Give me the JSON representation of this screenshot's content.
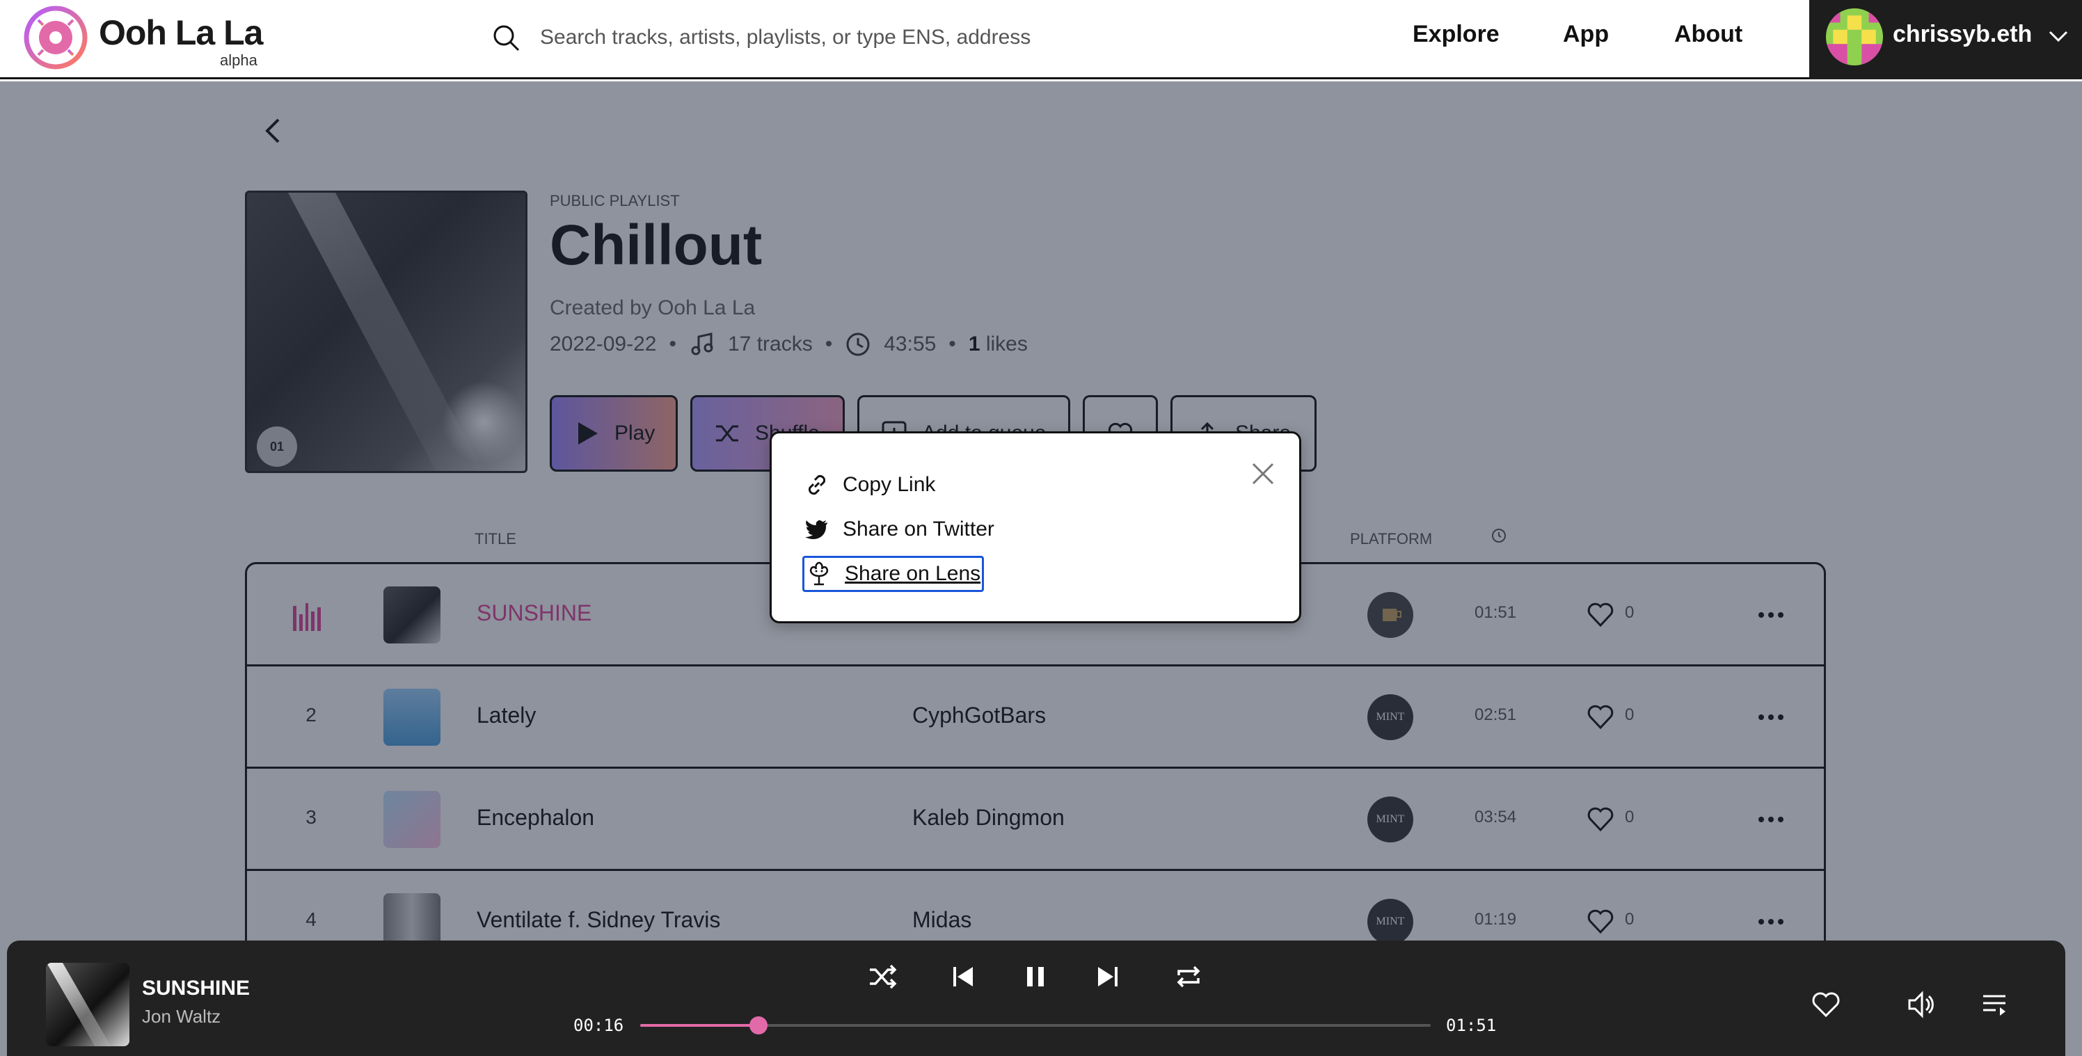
{
  "header": {
    "brand": "Ooh La La",
    "brand_tag": "alpha",
    "search_placeholder": "Search tracks, artists, playlists, or type ENS, address",
    "nav": [
      "Explore",
      "App",
      "About"
    ],
    "user": "chrissyb.eth"
  },
  "playlist": {
    "kind": "PUBLIC PLAYLIST",
    "title": "Chillout",
    "creator": "Created by Ooh La La",
    "date": "2022-09-22",
    "tracks": "17 tracks",
    "duration": "43:55",
    "likes_count": "1",
    "likes_label": "likes",
    "cover_label": "01"
  },
  "buttons": {
    "play": "Play",
    "shuffle": "Shuffle",
    "add_to_queue": "Add to queue",
    "share": "Share"
  },
  "columns": {
    "title": "TITLE",
    "platform": "PLATFORM"
  },
  "tracks": [
    {
      "num": "",
      "title": "SUNSHINE",
      "artist": "",
      "platform": "",
      "duration": "01:51",
      "likes": "0",
      "active": true
    },
    {
      "num": "2",
      "title": "Lately",
      "artist": "CyphGotBars",
      "platform": "MINT",
      "duration": "02:51",
      "likes": "0"
    },
    {
      "num": "3",
      "title": "Encephalon",
      "artist": "Kaleb Dingmon",
      "platform": "MINT",
      "duration": "03:54",
      "likes": "0"
    },
    {
      "num": "4",
      "title": "Ventilate f. Sidney Travis",
      "artist": "Midas",
      "platform": "MINT",
      "duration": "01:19",
      "likes": "0"
    }
  ],
  "share_modal": {
    "copy_link": "Copy Link",
    "twitter": "Share on Twitter",
    "lens": "Share on Lens"
  },
  "player": {
    "title": "SUNSHINE",
    "artist": "Jon Waltz",
    "elapsed": "00:16",
    "total": "01:51",
    "progress": 0.15
  },
  "colors": {
    "accent": "#e26aa8",
    "focus": "#1a56db",
    "player_bg": "#222222"
  }
}
